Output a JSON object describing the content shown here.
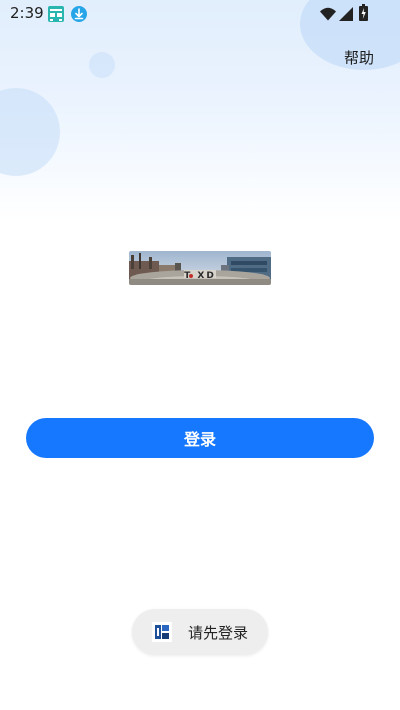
{
  "status_bar": {
    "time": "2:39",
    "icons": [
      "glasses-app-icon",
      "download-icon",
      "wifi-icon",
      "signal-icon",
      "battery-icon"
    ]
  },
  "header": {
    "help_label": "帮助"
  },
  "banner": {
    "image": "campus-photo",
    "label": "T XD"
  },
  "actions": {
    "login_label": "登录"
  },
  "toast": {
    "icon": "app-logo-icon",
    "message": "请先登录"
  },
  "colors": {
    "primary": "#1677ff",
    "header_gradient_top": "#e1eefc",
    "toast_bg": "#eeeeee"
  }
}
